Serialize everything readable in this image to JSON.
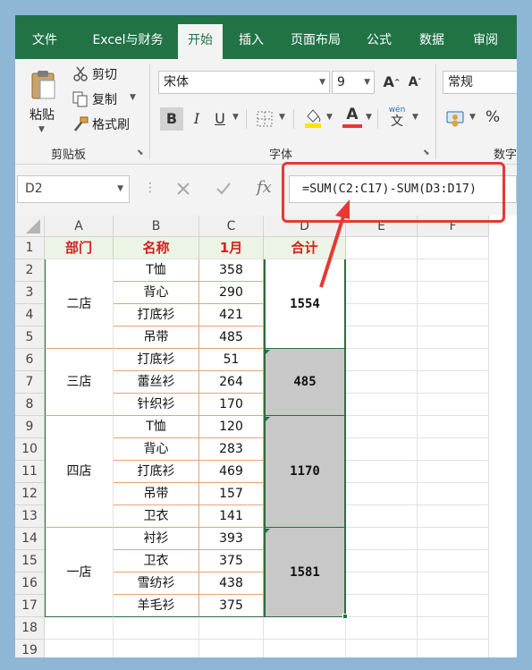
{
  "tabs": [
    {
      "label": "文件"
    },
    {
      "label": "Excel与财务"
    },
    {
      "label": "开始"
    },
    {
      "label": "插入"
    },
    {
      "label": "页面布局"
    },
    {
      "label": "公式"
    },
    {
      "label": "数据"
    },
    {
      "label": "审阅"
    }
  ],
  "ribbon": {
    "paste_label": "粘贴",
    "cut_label": "剪切",
    "copy_label": "复制",
    "format_painter_label": "格式刷",
    "clipboard_group": "剪贴板",
    "font_name": "宋体",
    "font_size": "9",
    "bold_label": "B",
    "italic_label": "I",
    "underline_label": "U",
    "font_color_letter": "A",
    "wen_label": "wén",
    "wen_char": "文",
    "font_group": "字体",
    "number_format": "常规",
    "percent_label": "%",
    "number_group": "数字"
  },
  "formula_bar": {
    "name_box": "D2",
    "fx_label": "fx",
    "formula": "=SUM(C2:C17)-SUM(D3:D17)"
  },
  "columns": [
    "A",
    "B",
    "C",
    "D",
    "E",
    "F"
  ],
  "rows": [
    "1",
    "2",
    "3",
    "4",
    "5",
    "6",
    "7",
    "8",
    "9",
    "10",
    "11",
    "12",
    "13",
    "14",
    "15",
    "16",
    "17",
    "18",
    "19"
  ],
  "headers": {
    "dept": "部门",
    "name": "名称",
    "month": "1月",
    "total": "合计"
  },
  "stores": [
    {
      "dept": "二店",
      "total": "1554",
      "items": [
        {
          "name": "T恤",
          "value": "358"
        },
        {
          "name": "背心",
          "value": "290"
        },
        {
          "name": "打底衫",
          "value": "421"
        },
        {
          "name": "吊带",
          "value": "485"
        }
      ]
    },
    {
      "dept": "三店",
      "total": "485",
      "items": [
        {
          "name": "打底衫",
          "value": "51"
        },
        {
          "name": "蕾丝衫",
          "value": "264"
        },
        {
          "name": "针织衫",
          "value": "170"
        }
      ]
    },
    {
      "dept": "四店",
      "total": "1170",
      "items": [
        {
          "name": "T恤",
          "value": "120"
        },
        {
          "name": "背心",
          "value": "283"
        },
        {
          "name": "打底衫",
          "value": "469"
        },
        {
          "name": "吊带",
          "value": "157"
        },
        {
          "name": "卫衣",
          "value": "141"
        }
      ]
    },
    {
      "dept": "一店",
      "total": "1581",
      "items": [
        {
          "name": "衬衫",
          "value": "393"
        },
        {
          "name": "卫衣",
          "value": "375"
        },
        {
          "name": "雪纺衫",
          "value": "438"
        },
        {
          "name": "羊毛衫",
          "value": "375"
        }
      ]
    }
  ],
  "colors": {
    "ribbon_green": "#217346",
    "header_text_red": "#d4201f",
    "highlight_red": "#e53935",
    "merged_grey": "#c8c8c8"
  }
}
